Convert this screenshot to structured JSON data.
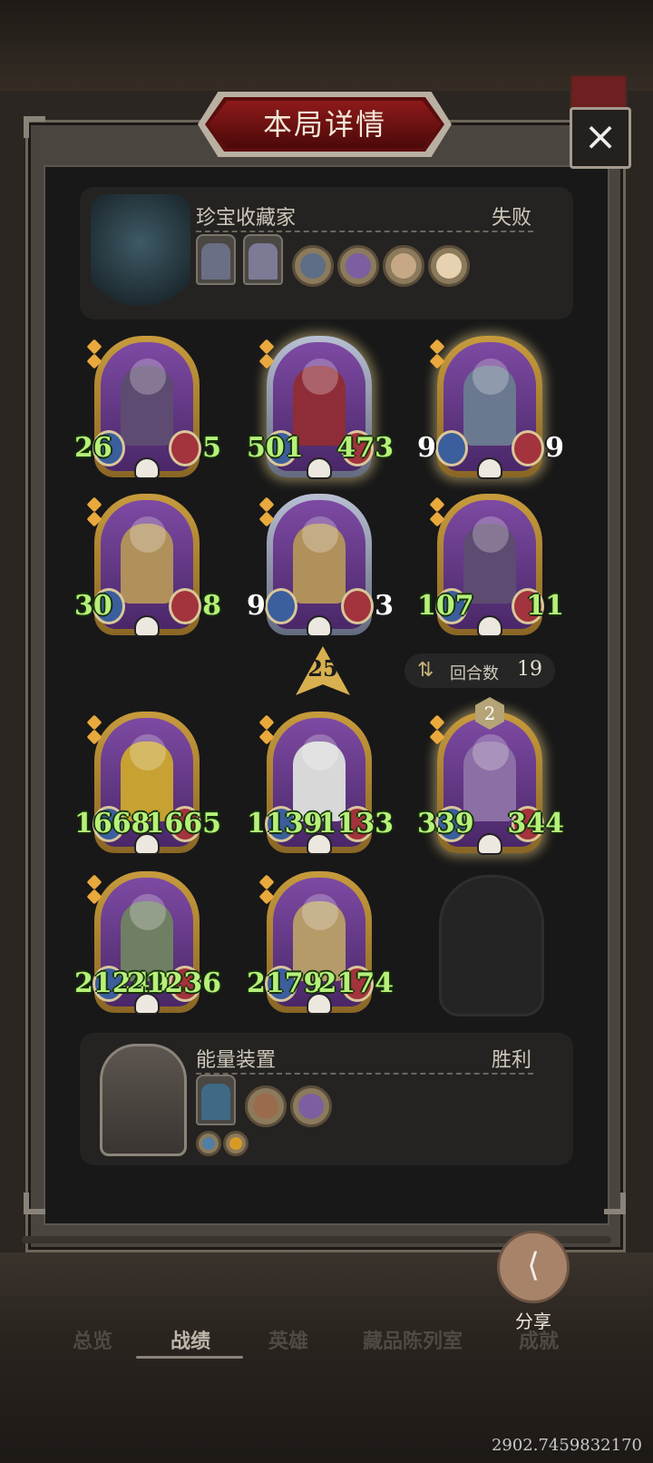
{
  "title": "本局详情",
  "close_icon": "×",
  "opponent": {
    "name": "珍宝收藏家",
    "result": "失败"
  },
  "player": {
    "name": "能量装置",
    "result": "胜利"
  },
  "opponent_board": [
    {
      "atk": "26",
      "hp": "5",
      "frame": "gold",
      "art": "#5e4b71"
    },
    {
      "atk": "501",
      "hp": "473",
      "frame": "silver",
      "art": "#8e2d37",
      "glow": true
    },
    {
      "atk": "9",
      "hp": "9",
      "frame": "gold",
      "art": "#6a7890",
      "glow": true,
      "white": true
    },
    {
      "atk": "30",
      "hp": "8",
      "frame": "gold",
      "art": "#b0905b"
    },
    {
      "atk": "9",
      "hp": "3",
      "frame": "silver",
      "art": "#b0905b",
      "white": true
    },
    {
      "atk": "107",
      "hp": "11",
      "frame": "gold",
      "art": "#5e4b71"
    }
  ],
  "player_board": [
    {
      "atk": "1668",
      "hp": "1665",
      "frame": "gold",
      "art": "#c7a232"
    },
    {
      "atk": "1139",
      "hp": "1133",
      "frame": "gold",
      "art": "#d8d8d8"
    },
    {
      "atk": "339",
      "hp": "344",
      "frame": "gold",
      "art": "#8c6fa5",
      "glow": true
    },
    {
      "atk": "21249",
      "hp": "21236",
      "frame": "gold",
      "art": "#6f7f63"
    },
    {
      "atk": "2179",
      "hp": "2174",
      "frame": "gold",
      "art": "#b59b6a"
    }
  ],
  "arrow_value": "25",
  "turn": {
    "label": "回合数",
    "value": "19"
  },
  "card_badge": "2",
  "share": {
    "label": "分享"
  },
  "nav": [
    "总览",
    "战绩",
    "英雄",
    "藏品陈列室",
    "成就"
  ],
  "nav_active": "战绩",
  "coords": "2902.7459832170",
  "icons": {
    "close": "close-icon",
    "share": "share-icon",
    "turn": "swap-arrows-icon",
    "skull": "skull-icon"
  }
}
